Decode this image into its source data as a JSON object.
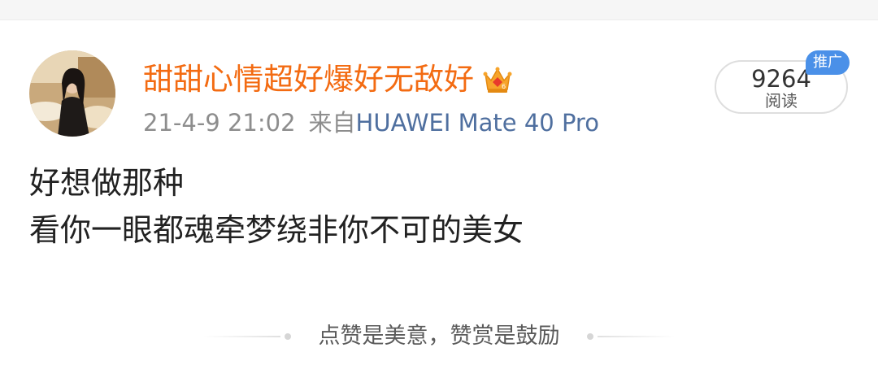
{
  "post": {
    "author": {
      "name": "甜甜心情超好爆好无敌好",
      "badge_icon": "crown-vip-icon"
    },
    "timestamp": "21-4-9 21:02",
    "source_prefix": "来自",
    "source_device": "HUAWEI Mate 40 Pro",
    "read_count": "9264",
    "read_label": "阅读",
    "promo_badge": "推广",
    "text_lines": [
      "好想做那种",
      "看你一眼都魂牵梦绕非你不可的美女"
    ],
    "reward_prompt": "点赞是美意，赞赏是鼓励"
  },
  "colors": {
    "username": "#f36b12",
    "source_link": "#4f6f9f",
    "promo_badge": "#4a90e8"
  }
}
